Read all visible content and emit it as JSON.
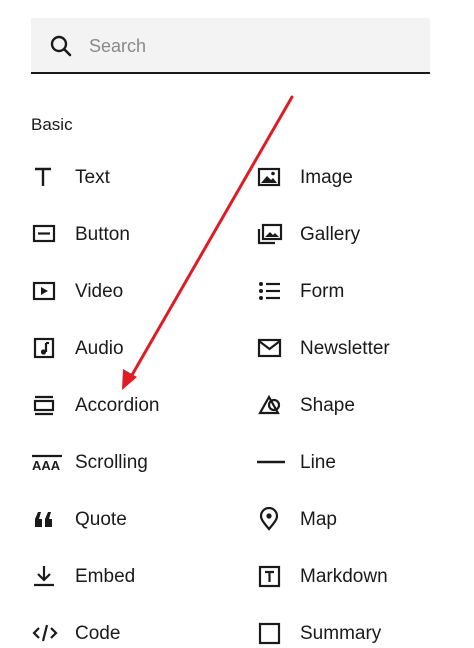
{
  "search": {
    "placeholder": "Search",
    "icon": "search-icon"
  },
  "section": {
    "title": "Basic"
  },
  "left_items": [
    {
      "label": "Text",
      "icon": "text-icon"
    },
    {
      "label": "Button",
      "icon": "button-icon"
    },
    {
      "label": "Video",
      "icon": "video-icon"
    },
    {
      "label": "Audio",
      "icon": "audio-icon"
    },
    {
      "label": "Accordion",
      "icon": "accordion-icon"
    },
    {
      "label": "Scrolling",
      "icon": "scrolling-icon"
    },
    {
      "label": "Quote",
      "icon": "quote-icon"
    },
    {
      "label": "Embed",
      "icon": "embed-icon"
    },
    {
      "label": "Code",
      "icon": "code-icon"
    }
  ],
  "right_items": [
    {
      "label": "Image",
      "icon": "image-icon"
    },
    {
      "label": "Gallery",
      "icon": "gallery-icon"
    },
    {
      "label": "Form",
      "icon": "form-icon"
    },
    {
      "label": "Newsletter",
      "icon": "newsletter-icon"
    },
    {
      "label": "Shape",
      "icon": "shape-icon"
    },
    {
      "label": "Line",
      "icon": "line-icon"
    },
    {
      "label": "Map",
      "icon": "map-pin-icon"
    },
    {
      "label": "Markdown",
      "icon": "markdown-icon"
    },
    {
      "label": "Summary",
      "icon": "summary-icon"
    }
  ],
  "annotation": {
    "arrow_color": "#e01b24"
  }
}
